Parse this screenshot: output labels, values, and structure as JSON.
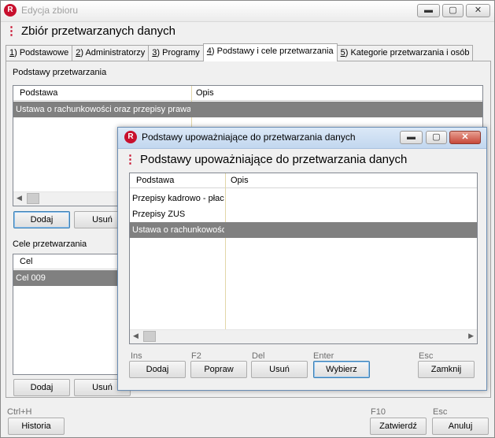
{
  "main_window": {
    "title": "Edycja zbioru",
    "heading": "Zbiór przetwarzanych danych",
    "controls": {
      "minimize": "▬",
      "maximize": "▢",
      "close": "✕"
    },
    "tabs": [
      {
        "key": "1",
        "rest": ") Podstawowe"
      },
      {
        "key": "2",
        "rest": ") Administratorzy"
      },
      {
        "key": "3",
        "rest": ") Programy"
      },
      {
        "key": "4",
        "rest": ") Podstawy i cele przetwarzania"
      },
      {
        "key": "5",
        "rest": ") Kategorie przetwarzania i osób"
      }
    ],
    "podstawy_section": {
      "label": "Podstawy przetwarzania",
      "columns": [
        "Podstawa",
        "Opis"
      ],
      "rows": [
        {
          "podstawa": "Ustawa o rachunkowości oraz przepisy prawa p",
          "opis": ""
        }
      ],
      "buttons": {
        "add": "Dodaj",
        "delete": "Usuń"
      }
    },
    "cele_section": {
      "label": "Cele przetwarzania",
      "columns": [
        "Cel"
      ],
      "rows": [
        {
          "cel": "Cel 009"
        }
      ],
      "buttons": {
        "add": "Dodaj",
        "delete": "Usuń"
      }
    },
    "footer": {
      "history_shortcut": "Ctrl+H",
      "history": "Historia",
      "confirm_shortcut": "F10",
      "confirm": "Zatwierdź",
      "cancel_shortcut": "Esc",
      "cancel": "Anuluj"
    }
  },
  "dialog": {
    "title": "Podstawy upoważniające do przetwarzania danych",
    "heading": "Podstawy upoważniające do przetwarzania danych",
    "columns": [
      "Podstawa",
      "Opis"
    ],
    "rows": [
      {
        "podstawa": "Przepisy kadrowo - płacowe",
        "opis": "",
        "selected": false
      },
      {
        "podstawa": "Przepisy ZUS",
        "opis": "",
        "selected": false
      },
      {
        "podstawa": "Ustawa o rachunkowości",
        "opis": "",
        "selected": true
      }
    ],
    "shortcuts": {
      "add": "Ins",
      "edit": "F2",
      "delete": "Del",
      "select": "Enter",
      "close": "Esc"
    },
    "buttons": {
      "add": "Dodaj",
      "edit": "Popraw",
      "delete": "Usuń",
      "select": "Wybierz",
      "close": "Zamknij"
    }
  },
  "colors": {
    "brand": "#c8102e",
    "selection": "#808080"
  }
}
